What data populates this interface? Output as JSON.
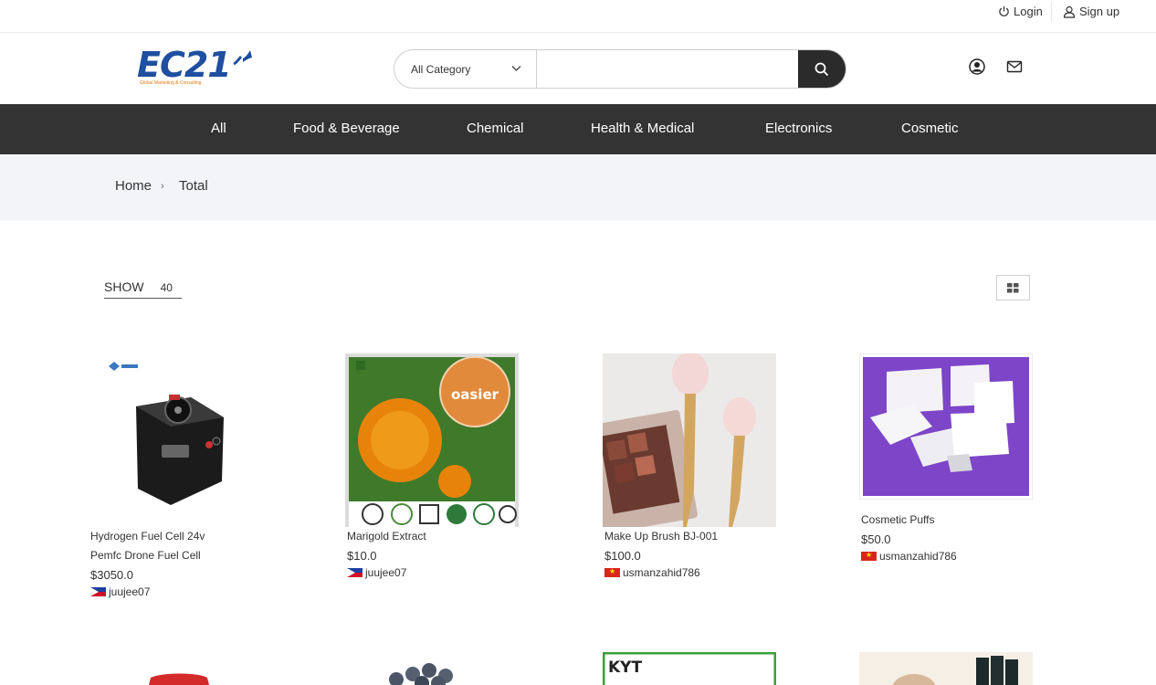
{
  "topbar": {
    "login_label": "Login",
    "signup_label": "Sign up"
  },
  "header": {
    "logo_text": "EC21",
    "logo_tagline": "Global Marketing & Consulting",
    "search": {
      "category_label": "All Category",
      "query": "",
      "placeholder": ""
    }
  },
  "nav": {
    "items": [
      "All",
      "Food & Beverage",
      "Chemical",
      "Health & Medical",
      "Electronics",
      "Cosmetic"
    ]
  },
  "breadcrumb": {
    "home": "Home",
    "separator": "›",
    "current": "Total"
  },
  "listing": {
    "show_label": "SHOW",
    "show_count": "40"
  },
  "products": [
    {
      "name_line1": "Hydrogen Fuel Cell 24v",
      "name_line2": "Pemfc Drone Fuel Cell",
      "price": "$3050.0",
      "seller": "juujee07",
      "flag": "ph"
    },
    {
      "name_line1": "Marigold Extract",
      "name_line2": "",
      "price": "$10.0",
      "seller": "juujee07",
      "flag": "ph",
      "image_text": "oasier"
    },
    {
      "name_line1": "Make Up Brush BJ-001",
      "name_line2": "",
      "price": "$100.0",
      "seller": "usmanzahid786",
      "flag": "vn"
    },
    {
      "name_line1": "Cosmetic Puffs",
      "name_line2": "",
      "price": "$50.0",
      "seller": "usmanzahid786",
      "flag": "vn"
    }
  ],
  "partial_row": {
    "third_image_text": "KYT"
  },
  "colors": {
    "nav_bg": "#333333",
    "search_btn": "#2b2b2b",
    "breadcrumb_bg": "#f3f4f8",
    "logo_blue": "#1e4fa0",
    "logo_orange": "#e07a10"
  }
}
